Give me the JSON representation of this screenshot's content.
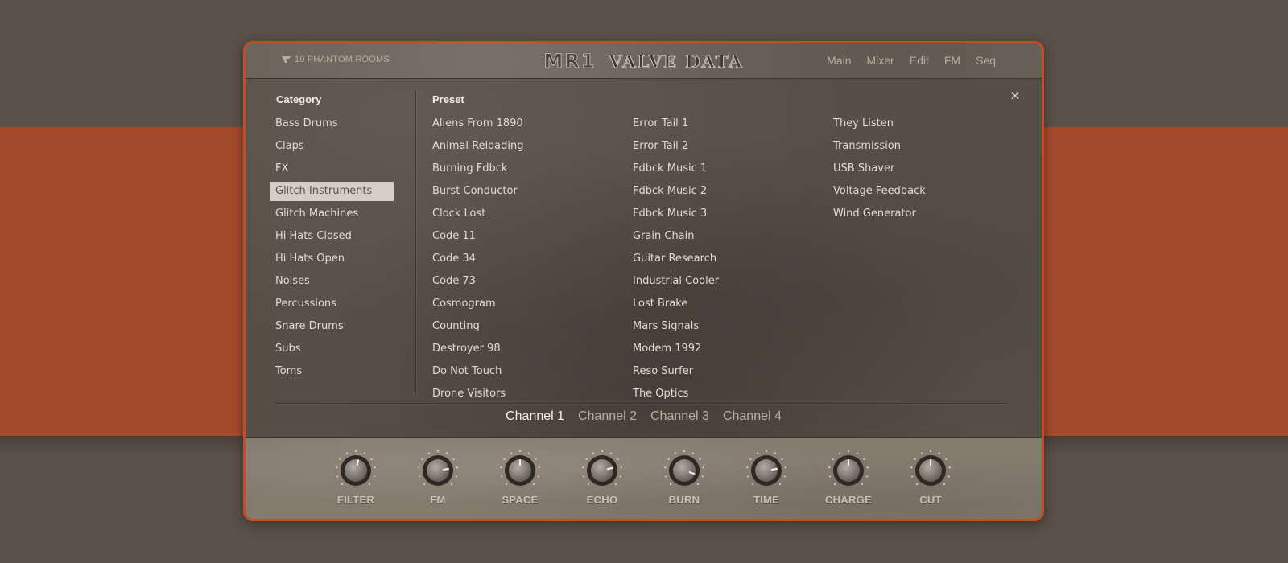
{
  "header": {
    "brand": "10 PHANTOM ROOMS",
    "title_main": "MR1",
    "title_sub": "VALVE DATA",
    "nav": [
      "Main",
      "Mixer",
      "Edit",
      "FM",
      "Seq"
    ]
  },
  "browser": {
    "category_header": "Category",
    "preset_header": "Preset",
    "close_icon": "×",
    "categories": [
      "Bass Drums",
      "Claps",
      "FX",
      "Glitch Instruments",
      "Glitch Machines",
      "Hi Hats Closed",
      "Hi Hats Open",
      "Noises",
      "Percussions",
      "Snare Drums",
      "Subs",
      "Toms"
    ],
    "selected_category": "Glitch Instruments",
    "presets_col1": [
      "Aliens From 1890",
      "Animal Reloading",
      "Burning Fdbck",
      "Burst Conductor",
      "Clock Lost",
      "Code 11",
      "Code 34",
      "Code 73",
      "Cosmogram",
      "Counting",
      "Destroyer 98",
      "Do Not Touch",
      "Drone Visitors"
    ],
    "presets_col2": [
      "Error Tail 1",
      "Error Tail 2",
      "Fdbck Music 1",
      "Fdbck Music 2",
      "Fdbck Music 3",
      "Grain Chain",
      "Guitar Research",
      "Industrial Cooler",
      "Lost Brake",
      "Mars Signals",
      "Modem 1992",
      "Reso Surfer",
      "The Optics"
    ],
    "presets_col3": [
      "They Listen",
      "Transmission",
      "USB Shaver",
      "Voltage Feedback",
      "Wind Generator"
    ]
  },
  "channels": {
    "items": [
      "Channel 1",
      "Channel 2",
      "Channel 3",
      "Channel 4"
    ],
    "active": "Channel 1"
  },
  "knobs": [
    {
      "label": "FILTER",
      "value": 0.55
    },
    {
      "label": "FM",
      "value": 0.8
    },
    {
      "label": "SPACE",
      "value": 0.5
    },
    {
      "label": "ECHO",
      "value": 0.78
    },
    {
      "label": "BURN",
      "value": 0.9
    },
    {
      "label": "TIME",
      "value": 0.8
    },
    {
      "label": "CHARGE",
      "value": 0.5
    },
    {
      "label": "CUT",
      "value": 0.5
    }
  ],
  "colors": {
    "accent": "#c04e2a",
    "background": "#595048",
    "band": "#a44a2c"
  }
}
